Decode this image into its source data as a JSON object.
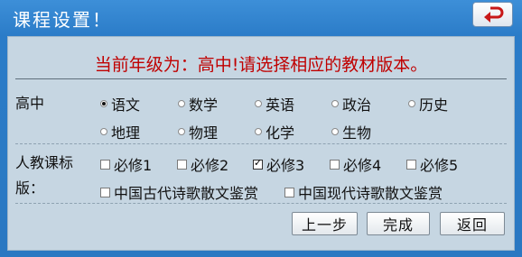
{
  "window": {
    "title": "课程设置！"
  },
  "headline": "当前年级为：高中!请选择相应的教材版本。",
  "subject_section": {
    "label": "高中",
    "row1": [
      "语文",
      "数学",
      "英语",
      "政治",
      "历史"
    ],
    "row2": [
      "地理",
      "物理",
      "化学",
      "生物"
    ],
    "selected": "语文"
  },
  "edition_section": {
    "label_line1": "人教课标",
    "label_line2": "版：",
    "row1": [
      "必修1",
      "必修2",
      "必修3",
      "必修4",
      "必修5"
    ],
    "row2": [
      "中国古代诗歌散文鉴赏",
      "中国现代诗歌散文鉴赏"
    ],
    "checked": "必修3"
  },
  "buttons": {
    "prev": "上一步",
    "finish": "完成",
    "back": "返回"
  },
  "colors": {
    "headline": "#c00000",
    "titlebar": "#2b7cc8",
    "panel": "#c6d6e2"
  },
  "icons": {
    "back": "return-arrow-icon"
  }
}
